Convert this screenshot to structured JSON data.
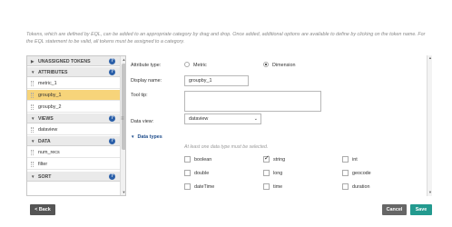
{
  "intro_text": "Tokens, which are defined by EQL, can be added to an appropriate category by drag and drop. Once added, additional options are available to define by clicking on the token name. For the EQL statement to be valid, all tokens must be assigned to a category.",
  "sidebar": {
    "sections": [
      {
        "label": "UNASSIGNED TOKENS"
      },
      {
        "label": "ATTRIBUTES"
      },
      {
        "label": "VIEWS"
      },
      {
        "label": "DATA"
      },
      {
        "label": "SORT"
      }
    ],
    "items": [
      {
        "label": "metric_1"
      },
      {
        "label": "groupby_1"
      },
      {
        "label": "groupby_2"
      },
      {
        "label": "dataview"
      },
      {
        "label": "num_recs"
      },
      {
        "label": "filter"
      }
    ],
    "help_glyph": "?"
  },
  "form": {
    "attribute_type_label": "Attribute type:",
    "metric_label": "Metric",
    "dimension_label": "Dimension",
    "selected_type": "Dimension",
    "display_name_label": "Display name:",
    "display_name_value": "groupby_1",
    "tooltip_label": "Tool tip:",
    "tooltip_value": "",
    "data_view_label": "Data view:",
    "data_view_value": "dataview",
    "data_types_title": "Data types",
    "data_types_hint": "At least one data type must be selected.",
    "data_types": [
      {
        "label": "boolean",
        "checked": false
      },
      {
        "label": "string",
        "checked": true
      },
      {
        "label": "int",
        "checked": false
      },
      {
        "label": "double",
        "checked": false
      },
      {
        "label": "long",
        "checked": false
      },
      {
        "label": "geocode",
        "checked": false
      },
      {
        "label": "dateTime",
        "checked": false
      },
      {
        "label": "time",
        "checked": false
      },
      {
        "label": "duration",
        "checked": false
      }
    ]
  },
  "footer": {
    "back_label": "< Back",
    "cancel_label": "Cancel",
    "save_label": "Save"
  },
  "colors": {
    "selected_item": "#f7d47a",
    "save_button": "#239a8f",
    "help_icon": "#2a5fa8",
    "data_types_title": "#1f4e8c"
  }
}
